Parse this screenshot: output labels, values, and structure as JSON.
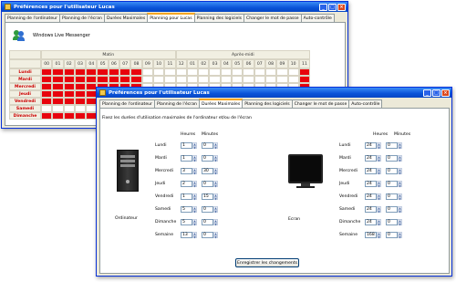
{
  "back_window": {
    "title": "Préférences pour l'utilisateur Lucas",
    "tabs": [
      "Planning de l'ordinateur",
      "Planning de l'écran",
      "Durées Maximales",
      "Planning pour Lucas",
      "Planning des logiciels",
      "Changer le mot de passe",
      "Auto-contrôle"
    ],
    "active_tab_index": 3,
    "user_label": "Windows Live Messenger",
    "grid": {
      "period_labels": [
        "Matin",
        "Après-midi"
      ],
      "hours": [
        "00",
        "01",
        "02",
        "03",
        "04",
        "05",
        "06",
        "07",
        "08",
        "09",
        "10",
        "11",
        "12",
        "01",
        "02",
        "03",
        "04",
        "05",
        "06",
        "07",
        "08",
        "09",
        "10",
        "11"
      ],
      "days": [
        {
          "name": "Lundi",
          "blocked": [
            1,
            1,
            1,
            1,
            1,
            1,
            1,
            1,
            1,
            0,
            0,
            0,
            0,
            0,
            0,
            0,
            0,
            0,
            0,
            0,
            0,
            0,
            0,
            1
          ]
        },
        {
          "name": "Mardi",
          "blocked": [
            1,
            1,
            1,
            1,
            1,
            1,
            1,
            1,
            1,
            0,
            0,
            0,
            0,
            0,
            0,
            0,
            0,
            0,
            0,
            0,
            0,
            0,
            0,
            1
          ]
        },
        {
          "name": "Mercredi",
          "blocked": [
            1,
            1,
            1,
            1,
            1,
            1,
            1,
            1,
            1,
            0,
            0,
            0,
            0,
            0,
            0,
            0,
            0,
            0,
            0,
            0,
            0,
            0,
            0,
            1
          ]
        },
        {
          "name": "Jeudi",
          "blocked": [
            1,
            1,
            1,
            1,
            1,
            1,
            1,
            1,
            1,
            0,
            0,
            0,
            0,
            0,
            0,
            0,
            0,
            0,
            0,
            0,
            0,
            0,
            0,
            1
          ]
        },
        {
          "name": "Vendredi",
          "blocked": [
            1,
            1,
            1,
            1,
            1,
            1,
            1,
            1,
            1,
            0,
            0,
            0,
            0,
            0,
            0,
            0,
            0,
            0,
            0,
            0,
            0,
            0,
            0,
            1
          ]
        },
        {
          "name": "Samedi",
          "blocked": [
            0,
            0,
            0,
            0,
            0,
            0,
            0,
            0,
            0,
            0,
            0,
            0,
            0,
            0,
            0,
            0,
            0,
            0,
            0,
            0,
            0,
            0,
            0,
            0
          ]
        },
        {
          "name": "Dimanche",
          "blocked": [
            1,
            1,
            1,
            1,
            1,
            1,
            1,
            1,
            1,
            0,
            0,
            0,
            0,
            0,
            0,
            0,
            0,
            0,
            0,
            0,
            0,
            0,
            0,
            1
          ]
        }
      ]
    }
  },
  "front_window": {
    "title": "Préférences pour l'utilisateur Lucas",
    "tabs": [
      "Planning de l'ordinateur",
      "Planning de l'écran",
      "Durées Maximales",
      "Planning des logiciels",
      "Changer le mot de passe",
      "Auto-contrôle"
    ],
    "active_tab_index": 2,
    "instructions": "Fixez les durées d'utilisation maximales de l'ordinateur et/ou de l'écran",
    "heures_label": "Heures",
    "minutes_label": "Minutes",
    "computer_label": "Ordinateur",
    "screen_label": "Ecran",
    "days": [
      "Lundi",
      "Mardi",
      "Mercredi",
      "Jeudi",
      "Vendredi",
      "Samedi",
      "Dimanche",
      "Semaine"
    ],
    "computer_values": [
      {
        "h": "1",
        "m": "0"
      },
      {
        "h": "1",
        "m": "0"
      },
      {
        "h": "3",
        "m": "30"
      },
      {
        "h": "2",
        "m": "0"
      },
      {
        "h": "1",
        "m": "15"
      },
      {
        "h": "5",
        "m": "0"
      },
      {
        "h": "5",
        "m": "0"
      },
      {
        "h": "13",
        "m": "0"
      }
    ],
    "screen_values": [
      {
        "h": "24",
        "m": "0"
      },
      {
        "h": "24",
        "m": "0"
      },
      {
        "h": "24",
        "m": "0"
      },
      {
        "h": "24",
        "m": "0"
      },
      {
        "h": "24",
        "m": "0"
      },
      {
        "h": "24",
        "m": "0"
      },
      {
        "h": "24",
        "m": "0"
      },
      {
        "h": "168",
        "m": "0"
      }
    ],
    "save_button": "Enregistrer les changements"
  },
  "colors": {
    "blocked": "#e8030d",
    "allowed": "#ffffff",
    "title_blue": "#0a53d8"
  }
}
